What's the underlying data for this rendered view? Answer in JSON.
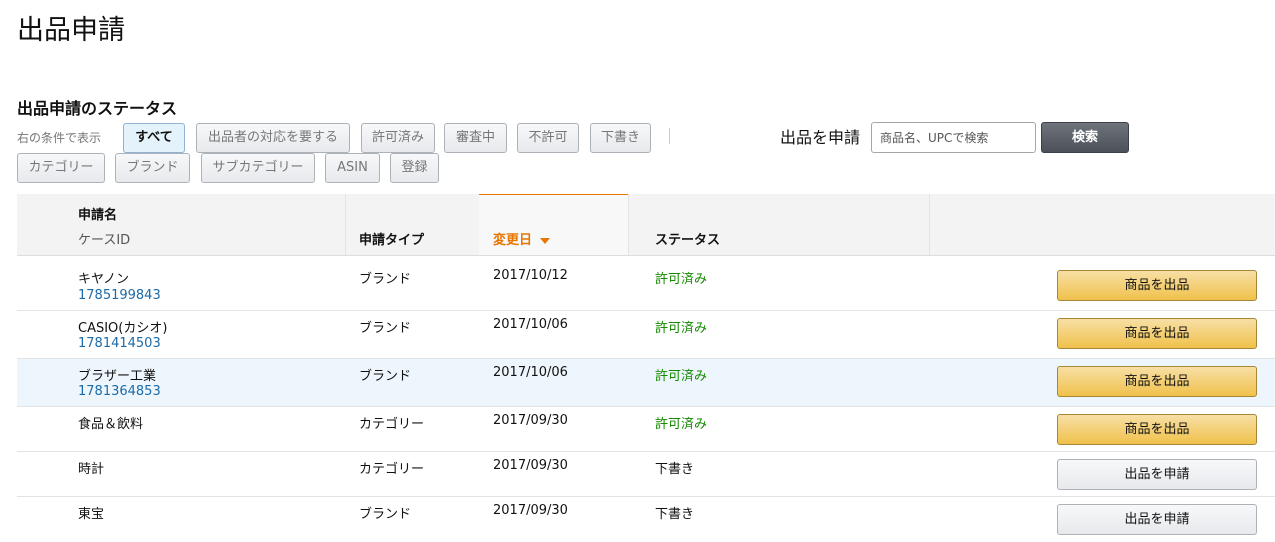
{
  "page": {
    "title": "出品申請"
  },
  "status_section": {
    "title": "出品申請のステータス",
    "filter_prefix": "右の条件で表示",
    "filters_row1": [
      "すべて",
      "出品者の対応を要する",
      "許可済み",
      "審査中",
      "不許可",
      "下書き"
    ],
    "filters_row2": [
      "カテゴリー",
      "ブランド",
      "サブカテゴリー",
      "ASIN",
      "登録"
    ],
    "active_filter": "すべて"
  },
  "apply_search": {
    "label": "出品を申請",
    "placeholder": "商品名、UPCで検索",
    "button_label": "検索"
  },
  "table": {
    "headers": {
      "name": "申請名",
      "case_id": "ケースID",
      "type": "申請タイプ",
      "date": "変更日",
      "status": "ステータス"
    },
    "rows": [
      {
        "name": "キヤノン",
        "case_id": "1785199843",
        "type": "ブランド",
        "date": "2017/10/12",
        "status": "許可済み",
        "action": "商品を出品"
      },
      {
        "name": "CASIO(カシオ)",
        "case_id": "1781414503",
        "type": "ブランド",
        "date": "2017/10/06",
        "status": "許可済み",
        "action": "商品を出品"
      },
      {
        "name": "ブラザー工業",
        "case_id": "1781364853",
        "type": "ブランド",
        "date": "2017/10/06",
        "status": "許可済み",
        "action": "商品を出品"
      },
      {
        "name": "食品＆飲料",
        "case_id": "",
        "type": "カテゴリー",
        "date": "2017/09/30",
        "status": "許可済み",
        "action": "商品を出品"
      },
      {
        "name": "時計",
        "case_id": "",
        "type": "カテゴリー",
        "date": "2017/09/30",
        "status": "下書き",
        "action": "出品を申請"
      },
      {
        "name": "東宝",
        "case_id": "",
        "type": "ブランド",
        "date": "2017/09/30",
        "status": "下書き",
        "action": "出品を申請"
      }
    ]
  },
  "colors": {
    "accent_orange": "#e77600",
    "approved_green": "#168a00",
    "link_blue": "#1c6aa8",
    "primary_button": "#f0c14b"
  }
}
